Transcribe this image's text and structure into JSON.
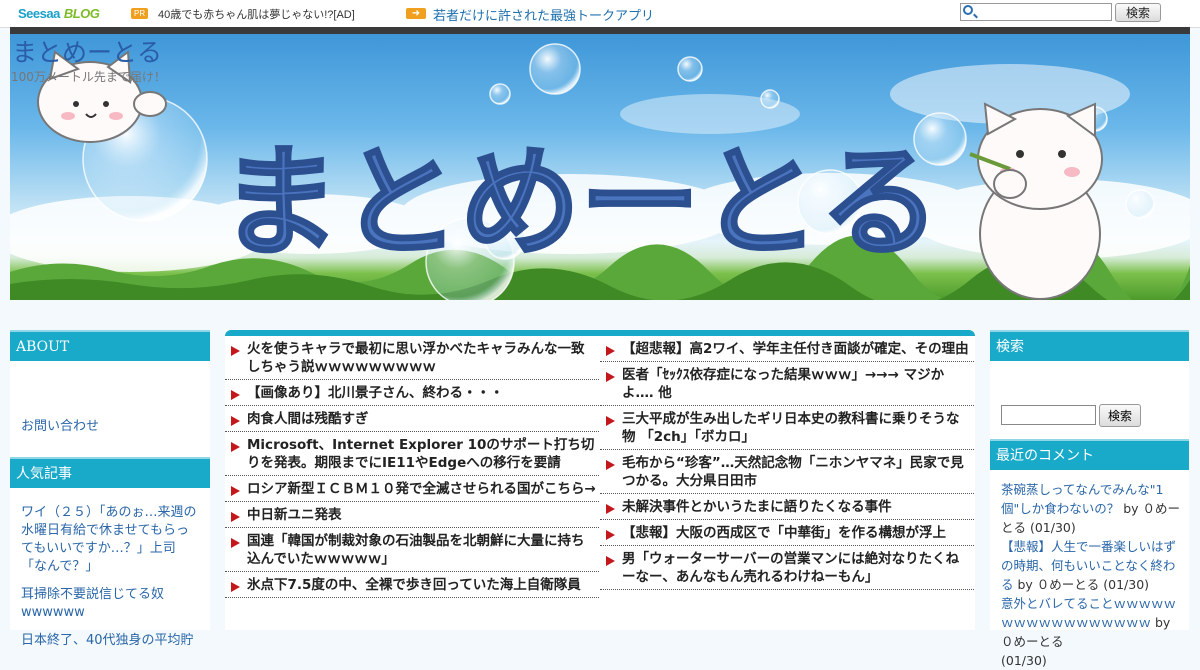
{
  "topbar": {
    "logo_main": "Seesaa",
    "logo_sub": "BLOG",
    "pr_badge": "PR",
    "ad_left": "40歳でも赤ちゃん肌は夢じゃない!?[AD]",
    "ad_right": "若者だけに許された最強トークアプリ",
    "search_value": "",
    "search_button": "検索"
  },
  "header": {
    "title": "まとめーとる",
    "tagline": "100万メートル先まで届け！",
    "banner_logo": "まとめーとる"
  },
  "left_sidebar": {
    "about_heading": "ABOUT",
    "about_link": "お問い合わせ",
    "popular_heading": "人気記事",
    "popular": [
      "ワイ（２５）「あのぉ…来週の水曜日有給で休ませてもらってもいいですか…？」上司「なんで？」",
      "耳掃除不要説信じてる奴wwwwww",
      "日本終了、40代独身の平均貯"
    ]
  },
  "main": {
    "left_column": [
      "火を使うキャラで最初に思い浮かべたキャラみんな一致しちゃう説ｗｗｗｗｗｗｗｗｗ",
      "【画像あり】北川景子さん、終わる・・・",
      "肉食人間は残酷すぎ",
      "Microsoft、Internet Explorer 10のサポート打ち切りを発表。期限までにIE11やEdgeへの移行を要請",
      "ロシア新型ＩＣＢＭ１０発で全滅させられる国がこちら→",
      "中日新ユニ発表",
      "国連「韓国が制裁対象の石油製品を北朝鮮に大量に持ち込んでいたｗｗｗｗｗ」",
      "氷点下7.5度の中、全裸で歩き回っていた海上自衛隊員"
    ],
    "right_column": [
      "【超悲報】高2ワイ、学年主任付き面談が確定、その理由",
      "医者「ｾｯｸｽ依存症になった結果ｗｗｗ」→→→ マジかよ‥‥ 他",
      "三大平成が生み出したギリ日本史の教科書に乗りそうな物 「2ch」「ボカロ」",
      "毛布から“珍客”…天然記念物「ニホンヤマネ」民家で見つかる。大分県日田市",
      "未解決事件とかいうたまに語りたくなる事件",
      "【悲報】大阪の西成区で「中華街」を作る構想が浮上",
      "男「ウォーターサーバーの営業マンには絶対なりたくねーなー、あんなもん売れるわけねーもん」"
    ]
  },
  "right_sidebar": {
    "search_heading": "検索",
    "search_button": "検索",
    "comments_heading": "最近のコメント",
    "comments": [
      {
        "title": "茶碗蒸しってなんでみんな\"1個\"しか食わないの？",
        "by": "by ０めーとる (01/30)"
      },
      {
        "title": "【悲報】人生で一番楽しいはずの時期、何もいいことなく終わる",
        "by": "by ０めーとる (01/30)"
      },
      {
        "title": "意外とバレてることｗｗｗｗｗｗｗｗｗｗｗｗｗｗｗｗｗ",
        "by": "by ０めーとる"
      },
      {
        "title": "",
        "by": "(01/30)"
      }
    ]
  },
  "colors": {
    "accent": "#19a9c9",
    "link": "#2a66a8",
    "bullet": "#c4171c"
  }
}
